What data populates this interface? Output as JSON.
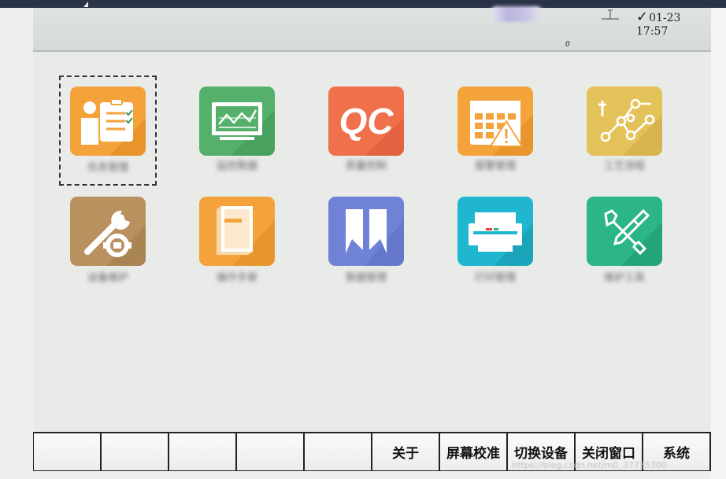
{
  "status": {
    "time": "01-23 17:57",
    "marker": "0"
  },
  "apps": [
    {
      "label": "任务管理",
      "icon": "task-checklist-icon",
      "color": "#f4a23a",
      "selected": true
    },
    {
      "label": "监控数据",
      "icon": "monitor-chart-icon",
      "color": "#54b06a",
      "selected": false
    },
    {
      "label": "质量控制",
      "icon": "qc-icon",
      "color": "#f0704c",
      "selected": false,
      "text": "QC"
    },
    {
      "label": "报警管理",
      "icon": "calendar-warning-icon",
      "color": "#f4a23a",
      "selected": false
    },
    {
      "label": "工艺流程",
      "icon": "flow-nodes-icon",
      "color": "#e4c25a",
      "selected": false
    },
    {
      "label": "设备维护",
      "icon": "wrench-gear-icon",
      "color": "#b8915e",
      "selected": false
    },
    {
      "label": "操作手册",
      "icon": "book-icon",
      "color": "#f4a23a",
      "selected": false
    },
    {
      "label": "数据管理",
      "icon": "split-blocks-icon",
      "color": "#6f82d6",
      "selected": false
    },
    {
      "label": "打印管理",
      "icon": "printer-icon",
      "color": "#20b6cf",
      "selected": false
    },
    {
      "label": "维护工具",
      "icon": "tools-icon",
      "color": "#2bb588",
      "selected": false
    }
  ],
  "toolbar": {
    "buttons": [
      "",
      "",
      "",
      "",
      "",
      "关于",
      "屏幕校准",
      "切换设备",
      "关闭窗口",
      "系统"
    ]
  },
  "watermark": "https://blog.csdn.net/m0_37735300"
}
